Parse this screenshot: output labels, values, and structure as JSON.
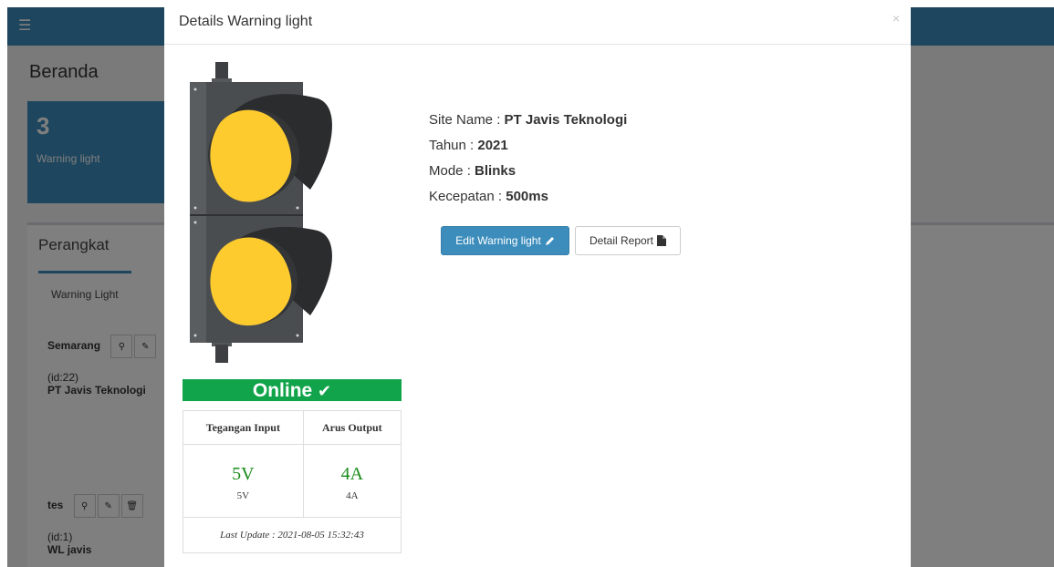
{
  "topbar": {
    "menu_icon": "hamburger-icon"
  },
  "page": {
    "title": "Beranda"
  },
  "stat": {
    "count": "3",
    "label": "Warning light"
  },
  "perangkat": {
    "title": "Perangkat",
    "tab_label": "Warning Light"
  },
  "devices": [
    {
      "group": "Semarang",
      "id": "(id:22)",
      "name": "PT Javis Teknologi"
    },
    {
      "group": "tes",
      "id": "(id:1)",
      "name": "WL javis"
    }
  ],
  "modal": {
    "title": "Details Warning light",
    "close_label": "×",
    "status": "Online",
    "status_icon": "check-icon",
    "readings": {
      "headers": [
        "Tegangan Input",
        "Arus Output"
      ],
      "voltage_value": "5V",
      "voltage_sub": "5V",
      "current_value": "4A",
      "current_sub": "4A",
      "last_update": "Last Update : 2021-08-05 15:32:43"
    },
    "info": [
      {
        "label": "Site Name : ",
        "value": "PT Javis Teknologi"
      },
      {
        "label": "Tahun : ",
        "value": "2021"
      },
      {
        "label": "Mode : ",
        "value": "Blinks"
      },
      {
        "label": "Kecepatan : ",
        "value": "500ms"
      }
    ],
    "edit_label": "Edit Warning light",
    "report_label": "Detail Report"
  },
  "colors": {
    "primary": "#3c8dbc",
    "online_green": "#11a44b",
    "light_yellow": "#fecb2f",
    "housing_gray": "#4a4d50"
  }
}
